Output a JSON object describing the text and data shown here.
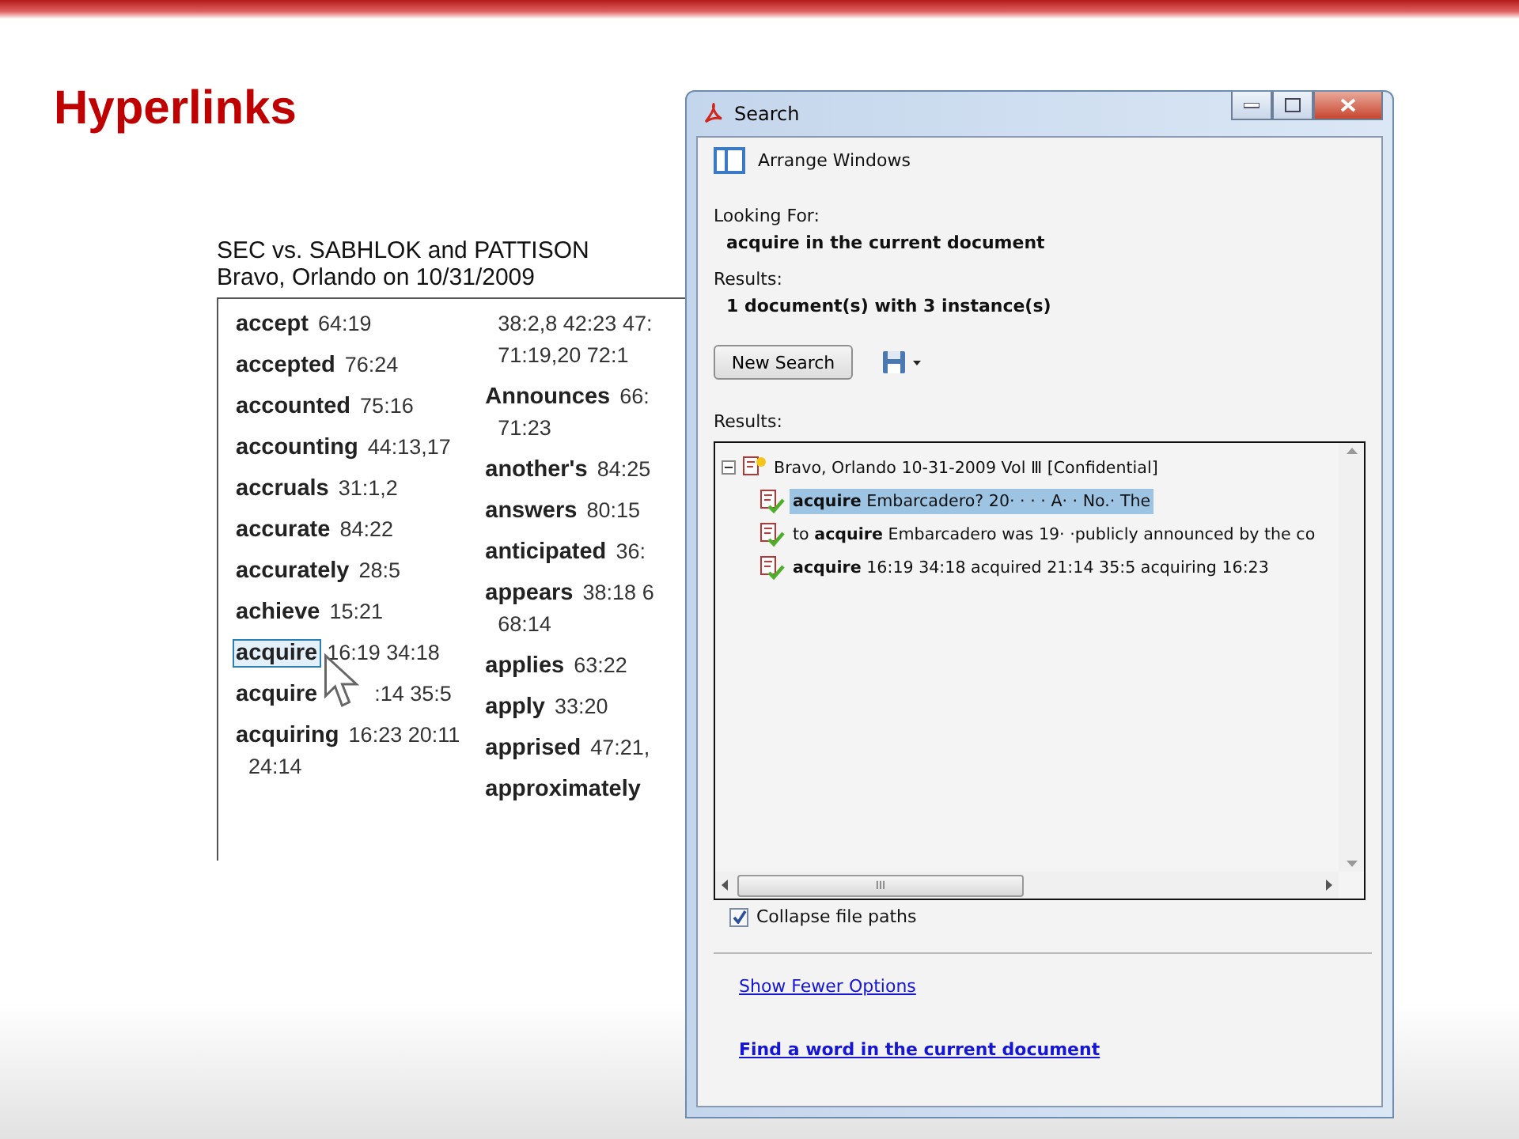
{
  "slide": {
    "title": "Hyperlinks"
  },
  "index": {
    "heading": [
      "SEC vs. SABHLOK and PATTISON",
      "Bravo, Orlando on 10/31/2009"
    ],
    "columns": [
      [
        {
          "word": "accept",
          "refs": [
            "64:19"
          ],
          "selected": false
        },
        {
          "word": "accepted",
          "refs": [
            "76:24"
          ],
          "selected": false
        },
        {
          "word": "accounted",
          "refs": [
            "75:16"
          ],
          "selected": false
        },
        {
          "word": "accounting",
          "refs": [
            "44:13,17"
          ],
          "selected": false
        },
        {
          "word": "accruals",
          "refs": [
            "31:1,2"
          ],
          "selected": false
        },
        {
          "word": "accurate",
          "refs": [
            "84:22"
          ],
          "selected": false
        },
        {
          "word": "accurately",
          "refs": [
            "28:5"
          ],
          "selected": false
        },
        {
          "word": "achieve",
          "refs": [
            "15:21"
          ],
          "selected": false
        },
        {
          "word": "acquire",
          "refs": [
            "16:19 34:18"
          ],
          "selected": true
        },
        {
          "word": "acquire",
          "refs": [
            ":14 35:5"
          ],
          "selected": false
        },
        {
          "word": "acquiring",
          "refs": [
            "16:23 20:11",
            "24:14"
          ],
          "selected": false
        }
      ],
      [
        {
          "refs": [
            "38:2,8 42:23 47:",
            "71:19,20 72:1"
          ]
        },
        {
          "word": "Announces",
          "refs": [
            "66:",
            "71:23"
          ],
          "selected": false
        },
        {
          "word": "another's",
          "refs": [
            "84:25"
          ],
          "selected": false
        },
        {
          "word": "answers",
          "refs": [
            "80:15"
          ],
          "selected": false
        },
        {
          "word": "anticipated",
          "refs": [
            "36:"
          ],
          "selected": false
        },
        {
          "word": "appears",
          "refs": [
            "38:18 6",
            "68:14"
          ],
          "selected": false
        },
        {
          "word": "applies",
          "refs": [
            "63:22"
          ],
          "selected": false
        },
        {
          "word": "apply",
          "refs": [
            "33:20"
          ],
          "selected": false
        },
        {
          "word": "apprised",
          "refs": [
            "47:21,"
          ],
          "selected": false
        },
        {
          "word": "approximately",
          "selected": false
        }
      ]
    ]
  },
  "window": {
    "title": "Search",
    "arrange": "Arrange Windows",
    "looking_label": "Looking For:",
    "looking_value": "acquire in the current document",
    "results_label": "Results:",
    "results_value": "1 document(s) with 3 instance(s)",
    "new_search": "New Search",
    "tree_label": "Results:",
    "tree": {
      "label": "Bravo, Orlando 10-31-2009 Vol Ⅲ [Confidential]",
      "expanded": true,
      "children": [
        {
          "text": "**acquire** Embarcadero? 20· · · · A· · No.· The",
          "selected": true
        },
        {
          "text": "to **acquire** Embarcadero was 19· ·publicly announced by the co",
          "selected": false
        },
        {
          "text": "**acquire** 16:19 34:18 acquired 21:14 35:5 acquiring 16:23",
          "selected": false
        }
      ]
    },
    "scroll_grip": "III",
    "collapse": {
      "label": "Collapse file paths",
      "checked": true
    },
    "links": [
      {
        "text": "Show Fewer Options",
        "bold": false
      },
      {
        "text": "Find a word in the current document",
        "bold": true
      }
    ]
  }
}
